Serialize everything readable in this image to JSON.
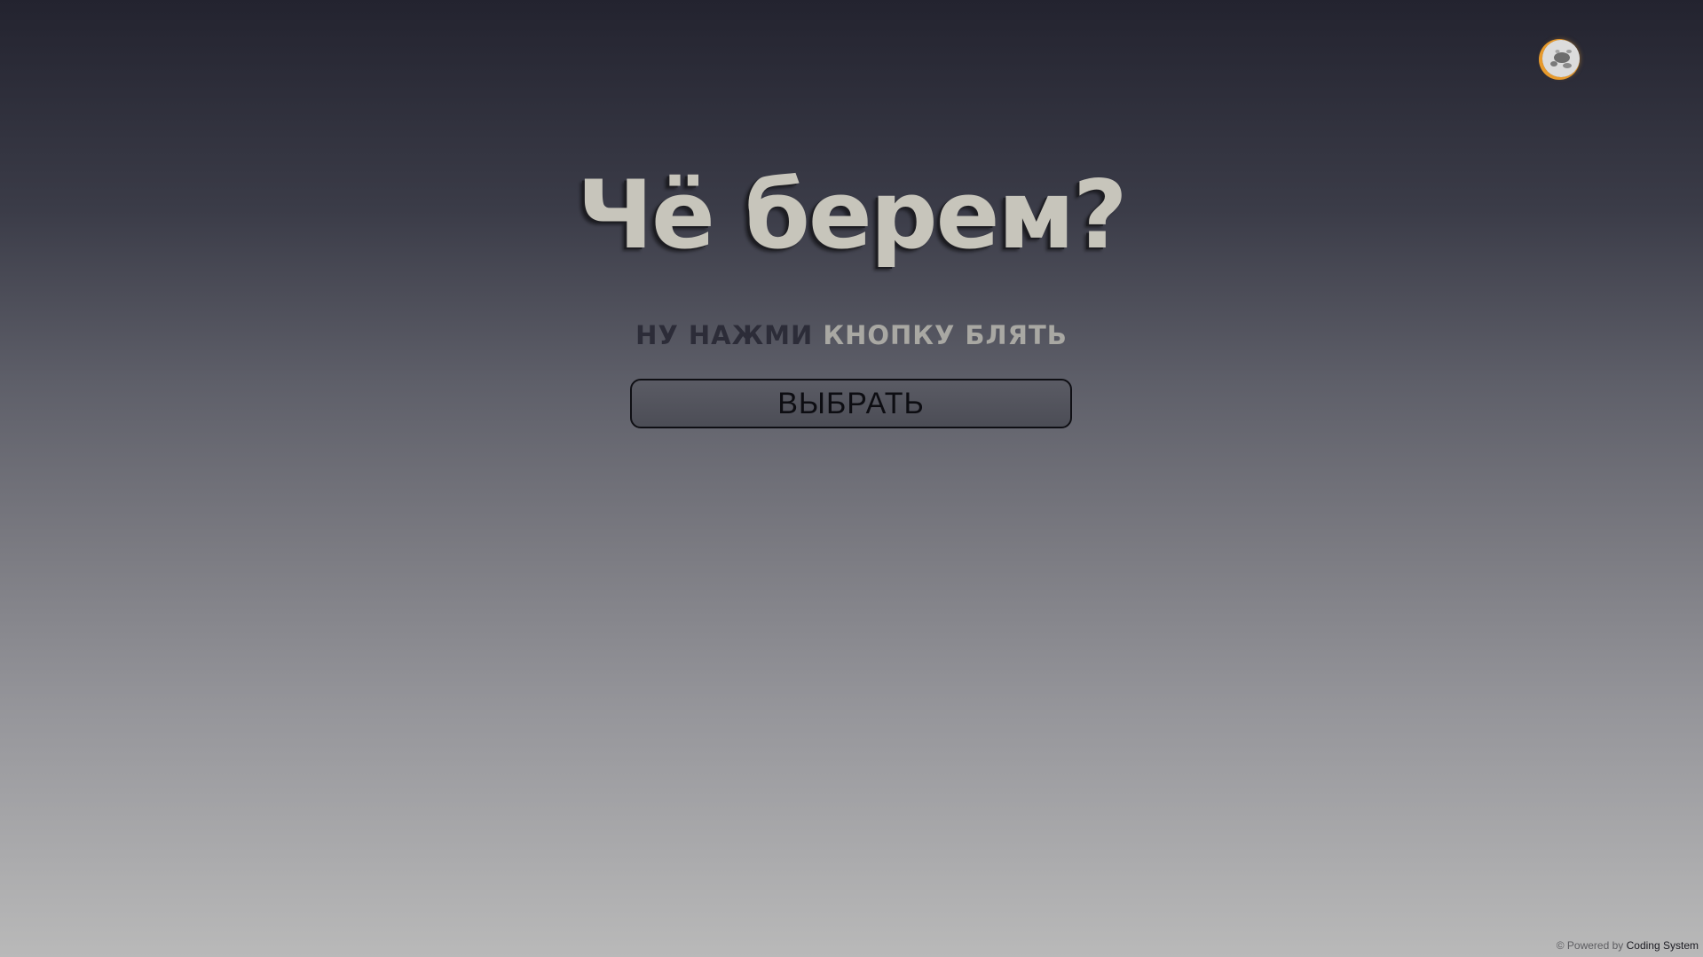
{
  "theme_toggle": {
    "icon": "moon-icon",
    "accent_color": "#e79a2c"
  },
  "hero": {
    "title": "Чё берем?",
    "subtitle_part1": "НУ НАЖМИ",
    "subtitle_part2": "КНОПКУ БЛЯТЬ"
  },
  "actions": {
    "choose_label": "ВЫБРАТЬ"
  },
  "footer": {
    "prefix": "© Powered by",
    "brand": "Coding System"
  }
}
